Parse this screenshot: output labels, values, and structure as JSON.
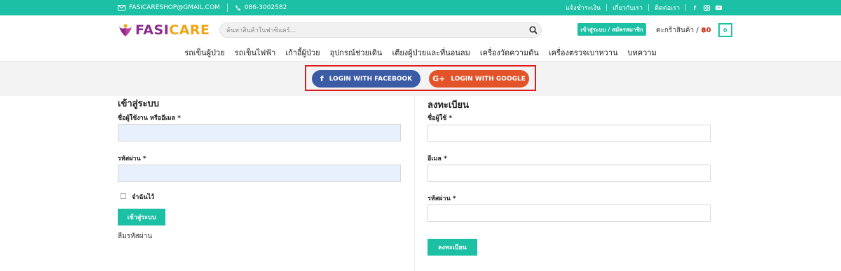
{
  "topbar": {
    "email": "FASICARESHOP@GMAIL.COM",
    "phone": "086-3002582",
    "links": [
      "แจ้งชำระเงิน",
      "เกี่ยวกับเรา",
      "ติดต่อเรา"
    ],
    "social": [
      "facebook-icon",
      "instagram-icon",
      "youtube-icon"
    ]
  },
  "header": {
    "logo_part1": "FASI",
    "logo_part2": "CARE",
    "search_placeholder": "ค้นหาสินค้าในฟาซิแคร์...",
    "login_register": "เข้าสู่ระบบ / สมัครสมาชิก",
    "cart_label": "ตะกร้าสินค้า /",
    "cart_price": "฿0",
    "cart_count": "0"
  },
  "nav": {
    "items": [
      "รถเข็นผู้ป่วย",
      "รถเข็นไฟฟ้า",
      "เก้าอี้ผู้ป่วย",
      "อุปกรณ์ช่วยเดิน",
      "เตียงผู้ป่วยและที่นอนลม",
      "เครื่องวัดความดัน",
      "เครื่องตรวจเบาหวาน",
      "บทความ"
    ]
  },
  "social_login": {
    "facebook": "LOGIN WITH FACEBOOK",
    "google": "LOGIN WITH GOOGLE",
    "facebook_glyph": "f",
    "google_glyph": "G+"
  },
  "login_form": {
    "title": "เข้าสู่ระบบ",
    "username_label": "ชื่อผู้ใช้งาน หรืออีเมล *",
    "password_label": "รหัสผ่าน *",
    "remember_label": "จำฉันไว้",
    "submit": "เข้าสู่ระบบ",
    "forgot": "ลืมรหัสผ่าน"
  },
  "register_form": {
    "title": "ลงทะเบียน",
    "username_label": "ชื่อผู้ใช้ *",
    "email_label": "อีเมล *",
    "password_label": "รหัสผ่าน *",
    "submit": "ลงทะเบียน"
  },
  "colors": {
    "accent": "#1cc0a5",
    "facebook": "#3b5ba5",
    "google": "#e2532a",
    "highlight": "#e01b1b",
    "logo_purple": "#8d2b8d",
    "logo_orange": "#f0a413"
  }
}
